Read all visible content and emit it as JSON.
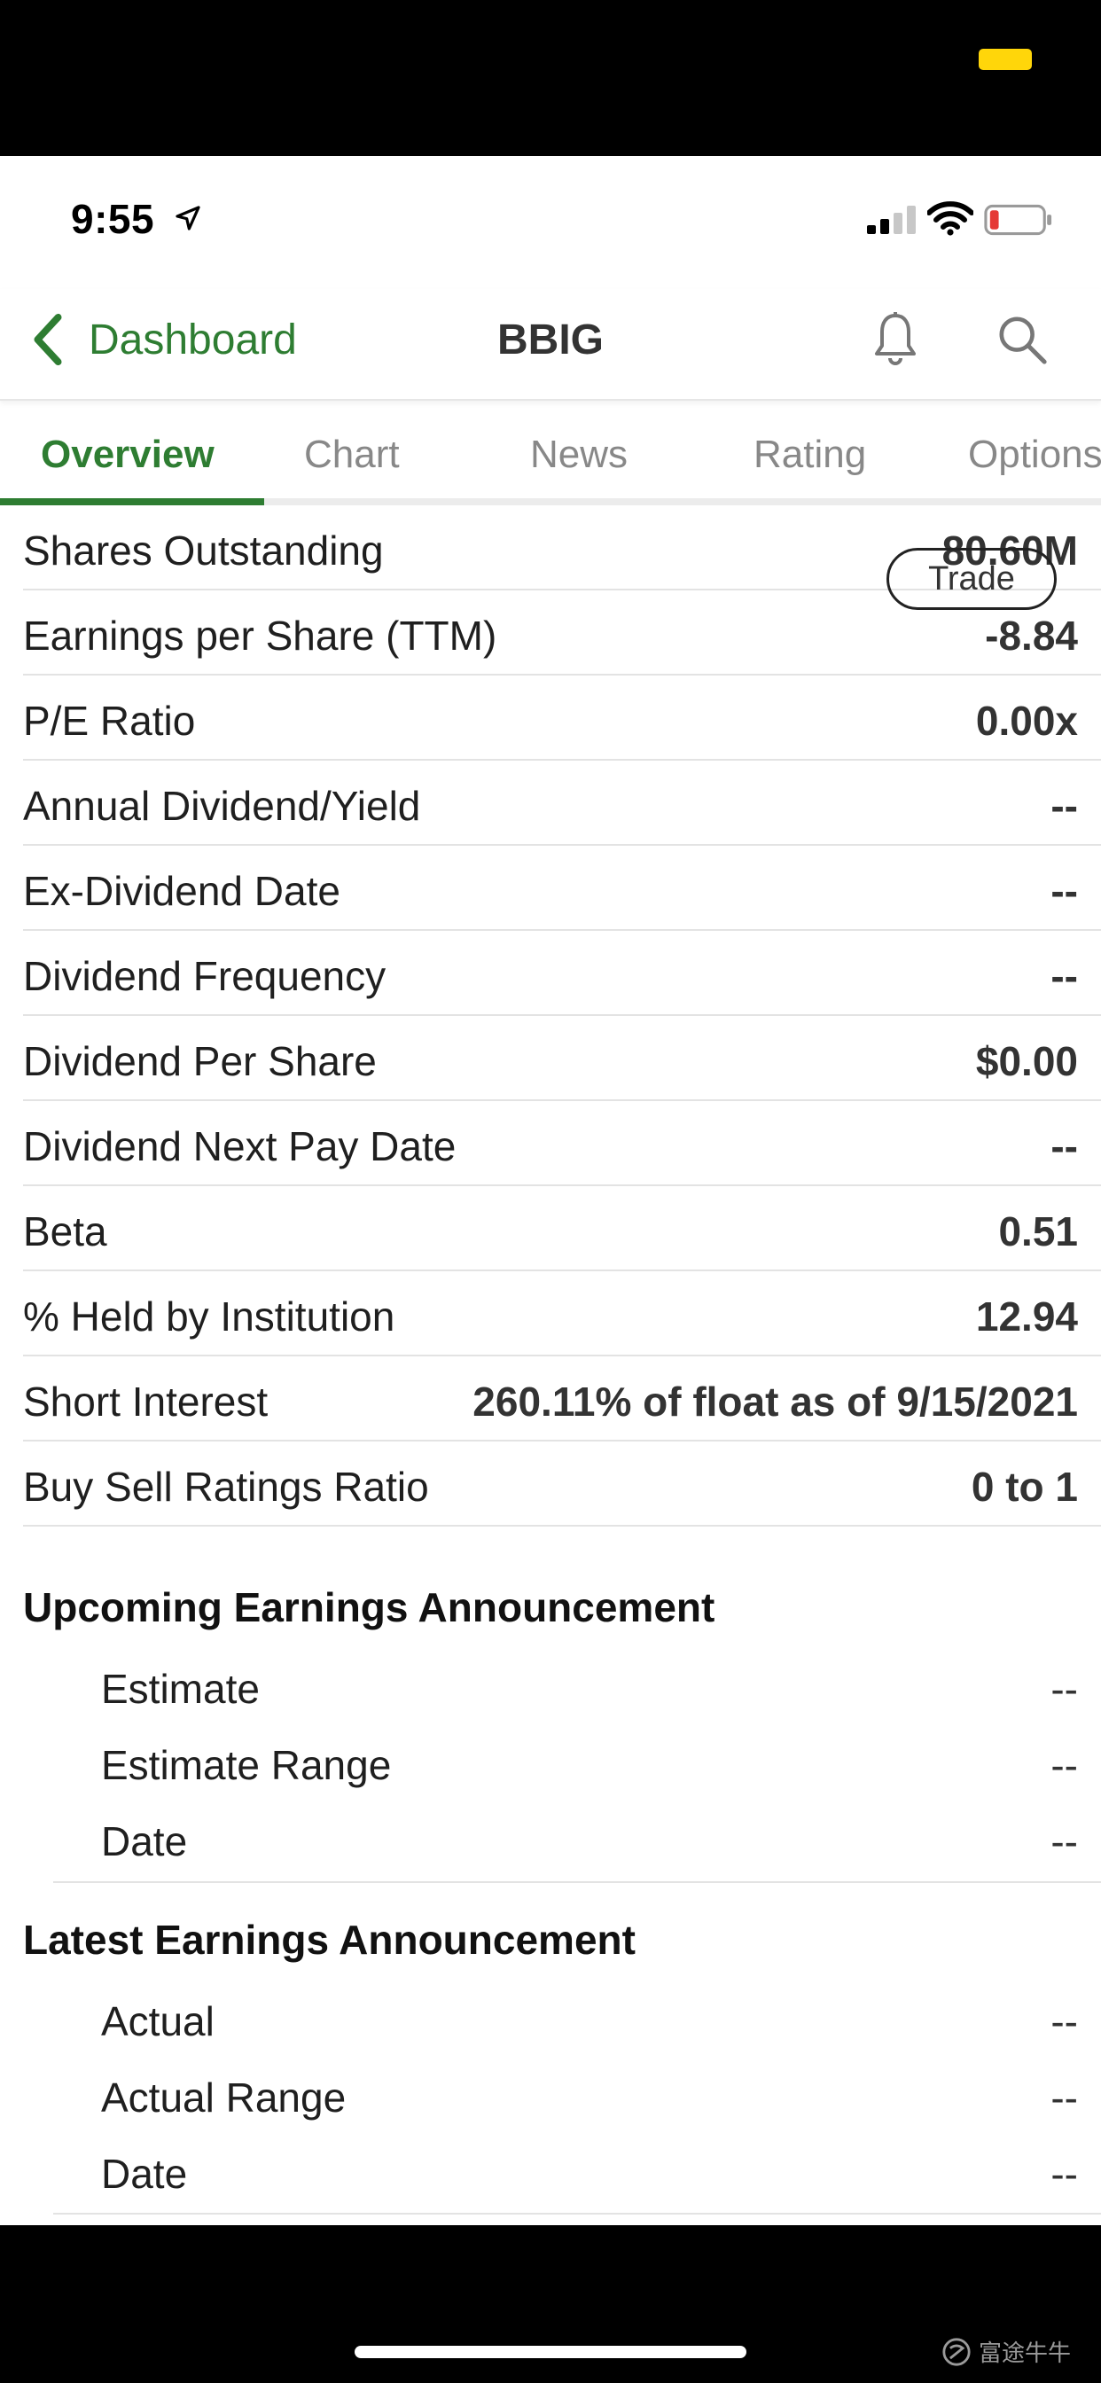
{
  "status_bar": {
    "time": "9:55"
  },
  "nav": {
    "back_label": "Dashboard",
    "title": "BBIG"
  },
  "tabs": [
    {
      "label": "Overview",
      "active": true
    },
    {
      "label": "Chart",
      "active": false
    },
    {
      "label": "News",
      "active": false
    },
    {
      "label": "Rating",
      "active": false
    },
    {
      "label": "Options",
      "active": false
    }
  ],
  "trade_button": "Trade",
  "stats": [
    {
      "label": "Shares Outstanding",
      "value": "80.60M"
    },
    {
      "label": "Earnings per Share (TTM)",
      "value": "-8.84"
    },
    {
      "label": "P/E Ratio",
      "value": "0.00x"
    },
    {
      "label": "Annual Dividend/Yield",
      "value": "--"
    },
    {
      "label": "Ex-Dividend Date",
      "value": "--"
    },
    {
      "label": "Dividend Frequency",
      "value": "--"
    },
    {
      "label": "Dividend Per Share",
      "value": "$0.00"
    },
    {
      "label": "Dividend Next Pay Date",
      "value": "--"
    },
    {
      "label": "Beta",
      "value": "0.51"
    },
    {
      "label": "% Held by Institution",
      "value": "12.94"
    },
    {
      "label": "Short Interest",
      "value": "260.11% of float as of 9/15/2021"
    },
    {
      "label": "Buy Sell Ratings Ratio",
      "value": "0 to 1"
    }
  ],
  "upcoming_earnings": {
    "title": "Upcoming Earnings Announcement",
    "rows": [
      {
        "label": "Estimate",
        "value": "--"
      },
      {
        "label": "Estimate Range",
        "value": "--"
      },
      {
        "label": "Date",
        "value": "--"
      }
    ]
  },
  "latest_earnings": {
    "title": "Latest Earnings Announcement",
    "rows": [
      {
        "label": "Actual",
        "value": "--"
      },
      {
        "label": "Actual Range",
        "value": "--"
      },
      {
        "label": "Date",
        "value": "--"
      }
    ]
  },
  "watermark": "富途牛牛",
  "colors": {
    "accent": "#2e7d32",
    "battery_low": "#e53935",
    "notch_pill": "#ffd60a"
  }
}
